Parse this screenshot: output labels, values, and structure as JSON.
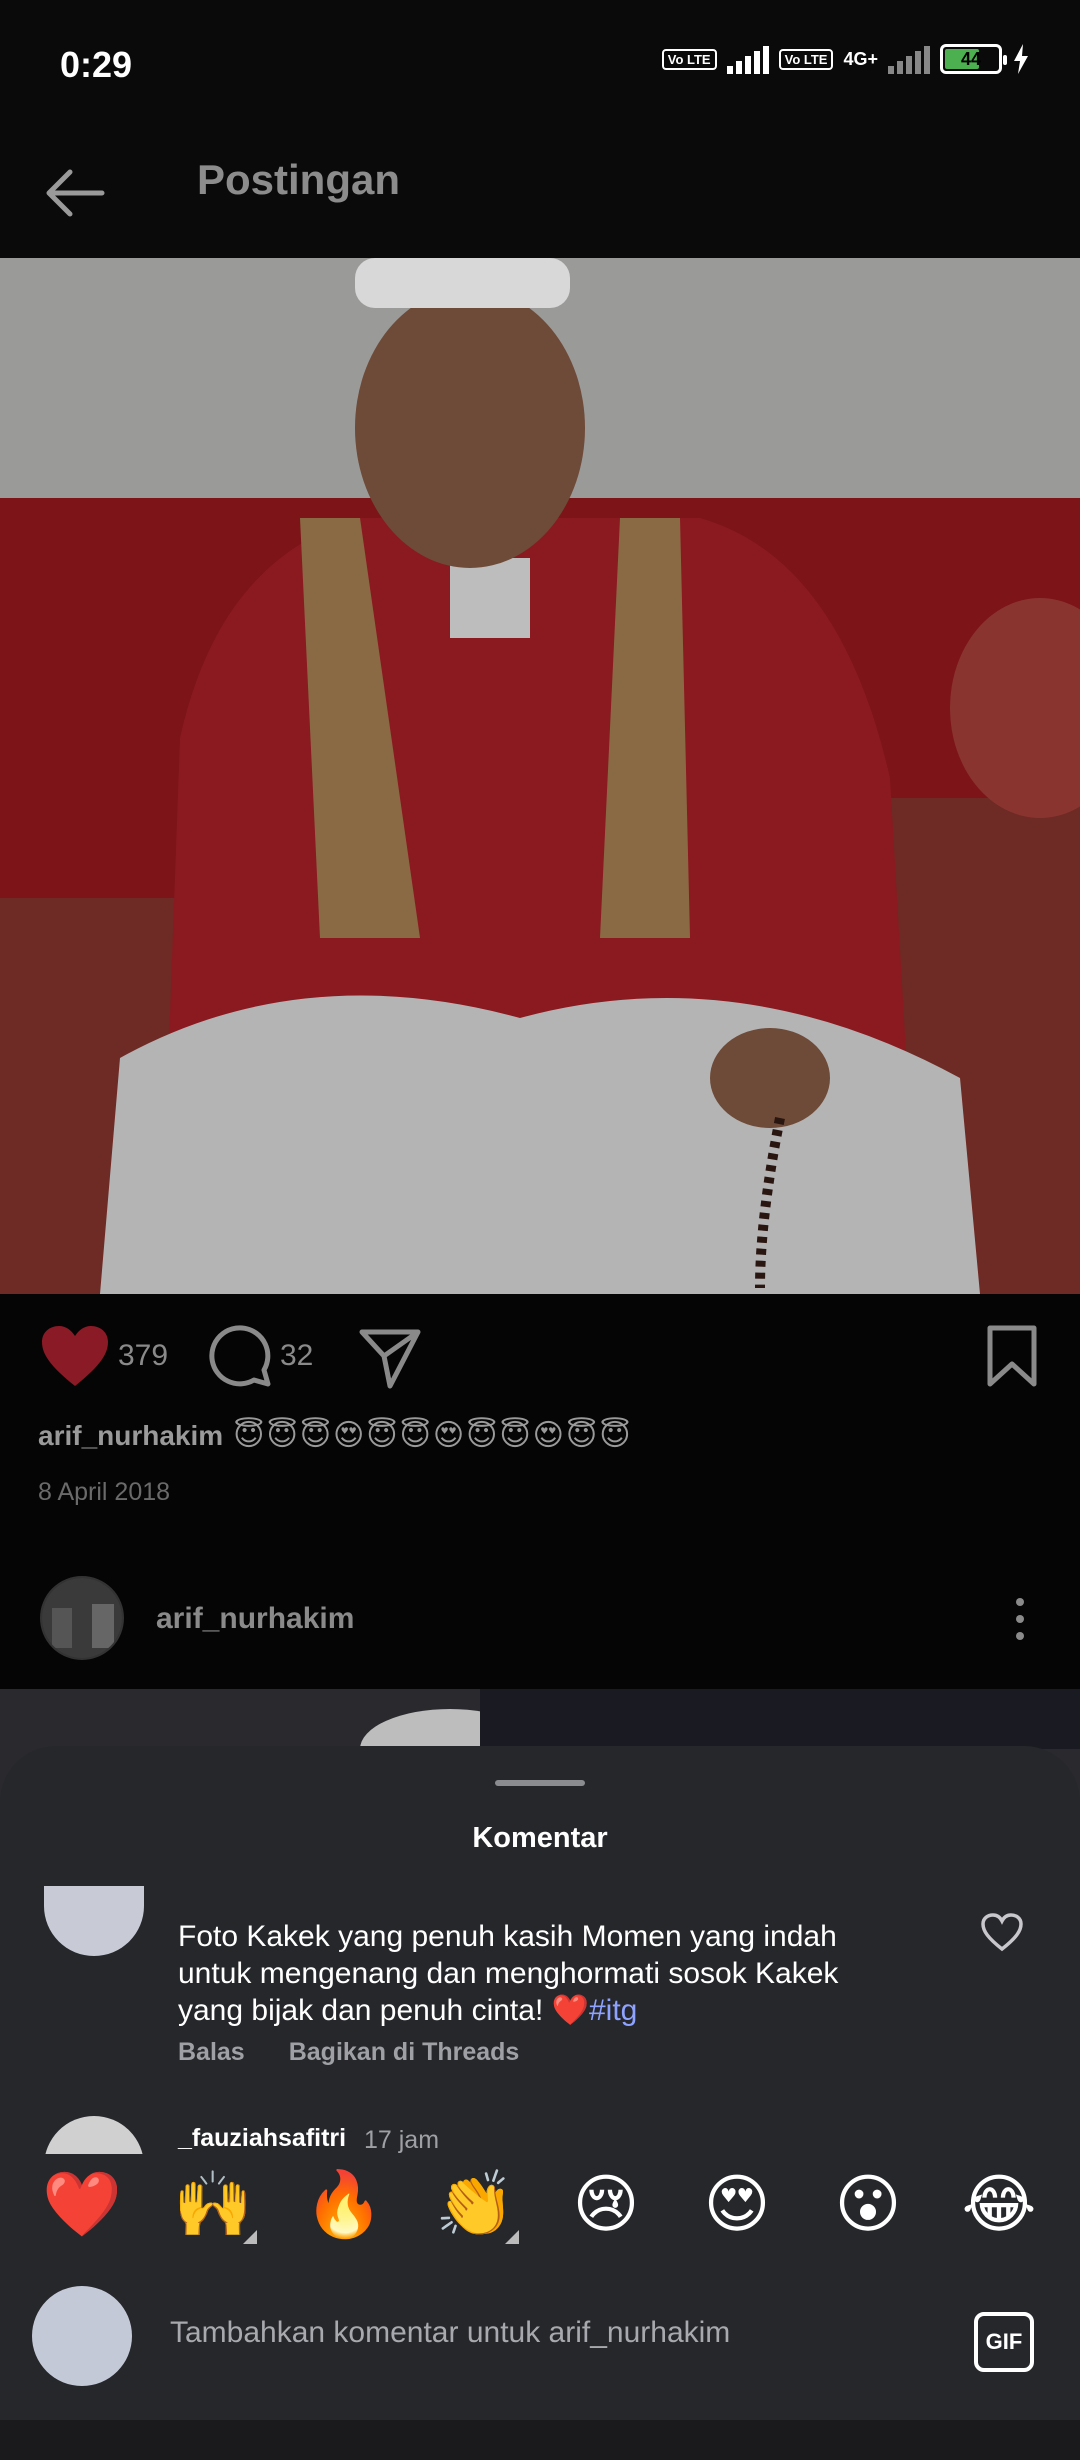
{
  "status_bar": {
    "time": "0:29",
    "volte1": "Vo LTE",
    "volte2": "Vo LTE",
    "network": "4G+",
    "battery": "44",
    "battery_level": 0.44
  },
  "header": {
    "title": "Postingan",
    "back_icon": "arrow-left-icon"
  },
  "post": {
    "likes": "379",
    "comments": "32",
    "like_color": "#e0243a",
    "caption_user": "arif_nurhakim",
    "caption_emojis": "😇😇😇😍😇😇😍😇😇😍😇😇",
    "date": "8 April 2018"
  },
  "next_post": {
    "username": "arif_nurhakim"
  },
  "comments_sheet": {
    "title": "Komentar",
    "comment1": {
      "line1": "Foto Kakek yang penuh kasih Momen yang indah",
      "line2": "untuk mengenang dan menghormati sosok Kakek",
      "line3_prefix": "yang bijak dan penuh cinta! ❤️",
      "hashtag": "#itg",
      "reply": "Balas",
      "share": "Bagikan di Threads"
    },
    "comment2": {
      "username": "_fauziahsafitri",
      "time": "17 jam"
    },
    "reactions": [
      "❤️",
      "🙌",
      "🔥",
      "👏",
      "😢",
      "😍",
      "😮",
      "😂"
    ],
    "input_placeholder": "Tambahkan komentar untuk arif_nurhakim",
    "gif_label": "GIF"
  }
}
